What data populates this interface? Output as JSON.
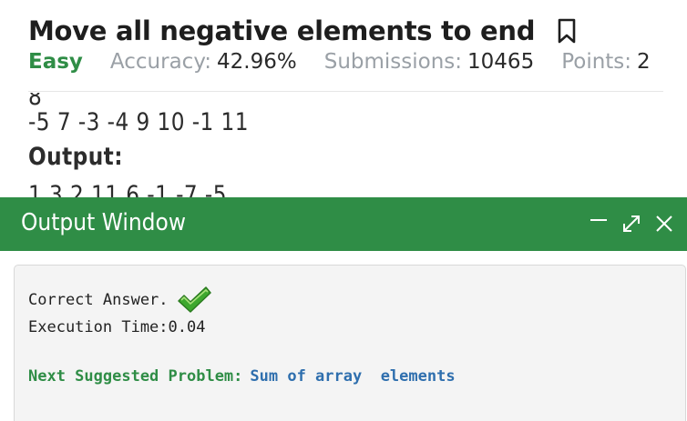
{
  "problem": {
    "title": "Move all negative elements to end",
    "difficulty": "Easy",
    "accuracy_label": "Accuracy:",
    "accuracy_value": "42.96%",
    "submissions_label": "Submissions:",
    "submissions_value": "10465",
    "points_label": "Points:",
    "points_value": "2"
  },
  "body": {
    "cut_top_line": "8",
    "input_line": "-5 7 -3 -4 9 10 -1 11",
    "output_label": "Output:",
    "output_line": "1 3 2 11 6 -1 -7 -5"
  },
  "output_window": {
    "title": "Output Window",
    "result_text": "Correct Answer.",
    "execution_time": "Execution Time:0.04",
    "next_label": "Next Suggested Problem:",
    "next_link": "Sum of array  elements"
  },
  "colors": {
    "brand_green": "#2f8d46",
    "link_blue": "#2f6fae"
  },
  "icons": {
    "bookmark": "bookmark-icon",
    "minimize": "minimize-icon",
    "expand": "expand-icon",
    "close": "close-icon",
    "check": "checkmark-icon"
  }
}
